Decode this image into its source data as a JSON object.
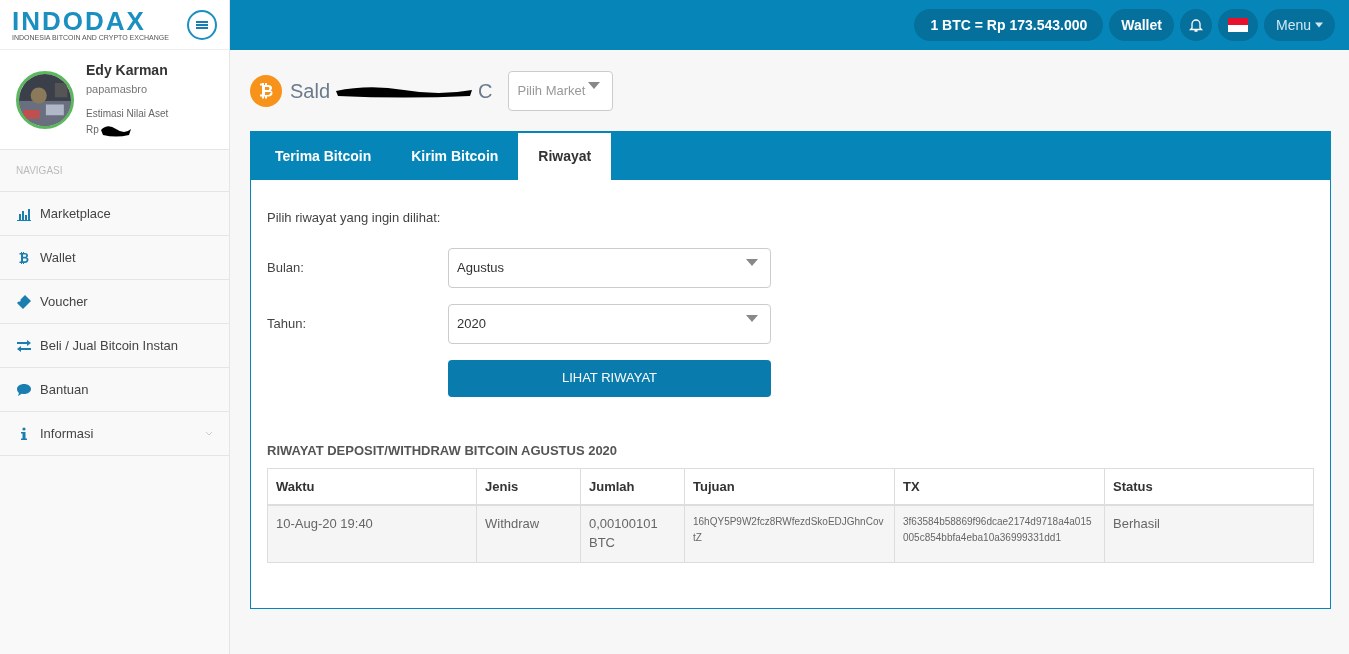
{
  "logo": {
    "name": "INDODAX",
    "tagline": "INDONESIA BITCOIN AND CRYPTO EXCHANGE"
  },
  "topbar": {
    "price": "1 BTC = Rp 173.543.000",
    "wallet": "Wallet",
    "menu": "Menu"
  },
  "profile": {
    "name": "Edy Karman",
    "username": "papamasbro",
    "asset_label": "Estimasi Nilai Aset",
    "asset_prefix": "Rp"
  },
  "nav_heading": "NAVIGASI",
  "sidebar": {
    "items": [
      {
        "label": "Marketplace",
        "kind": "chart",
        "expandable": false
      },
      {
        "label": "Wallet",
        "kind": "bitcoin",
        "expandable": false
      },
      {
        "label": "Voucher",
        "kind": "ticket",
        "expandable": false
      },
      {
        "label": "Beli / Jual Bitcoin Instan",
        "kind": "transfer",
        "expandable": false
      },
      {
        "label": "Bantuan",
        "kind": "chat",
        "expandable": false
      },
      {
        "label": "Informasi",
        "kind": "info",
        "expandable": true
      }
    ]
  },
  "balance": {
    "prefix": "Sald",
    "suffix": "C",
    "market_placeholder": "Pilih Market"
  },
  "tabs": [
    {
      "label": "Terima Bitcoin",
      "selected": false
    },
    {
      "label": "Kirim Bitcoin",
      "selected": false
    },
    {
      "label": "Riwayat",
      "selected": true
    }
  ],
  "form": {
    "intro": "Pilih riwayat yang ingin dilihat:",
    "month_label": "Bulan:",
    "month": "Agustus",
    "year_label": "Tahun:",
    "year": "2020",
    "button": "LIHAT RIWAYAT"
  },
  "table": {
    "title": "RIWAYAT DEPOSIT/WITHDRAW BITCOIN AGUSTUS 2020",
    "columns": [
      "Waktu",
      "Jenis",
      "Jumlah",
      "Tujuan",
      "TX",
      "Status"
    ],
    "rows": [
      [
        "10-Aug-20 19:40",
        "Withdraw",
        "0,00100101 BTC",
        "16hQY5P9W2fcz8RWfezdSkoEDJGhnCovtZ",
        "3f63584b58869f96dcae2174d9718a4a015005c854bbfa4eba10a36999331dd1",
        "Berhasil"
      ]
    ]
  }
}
